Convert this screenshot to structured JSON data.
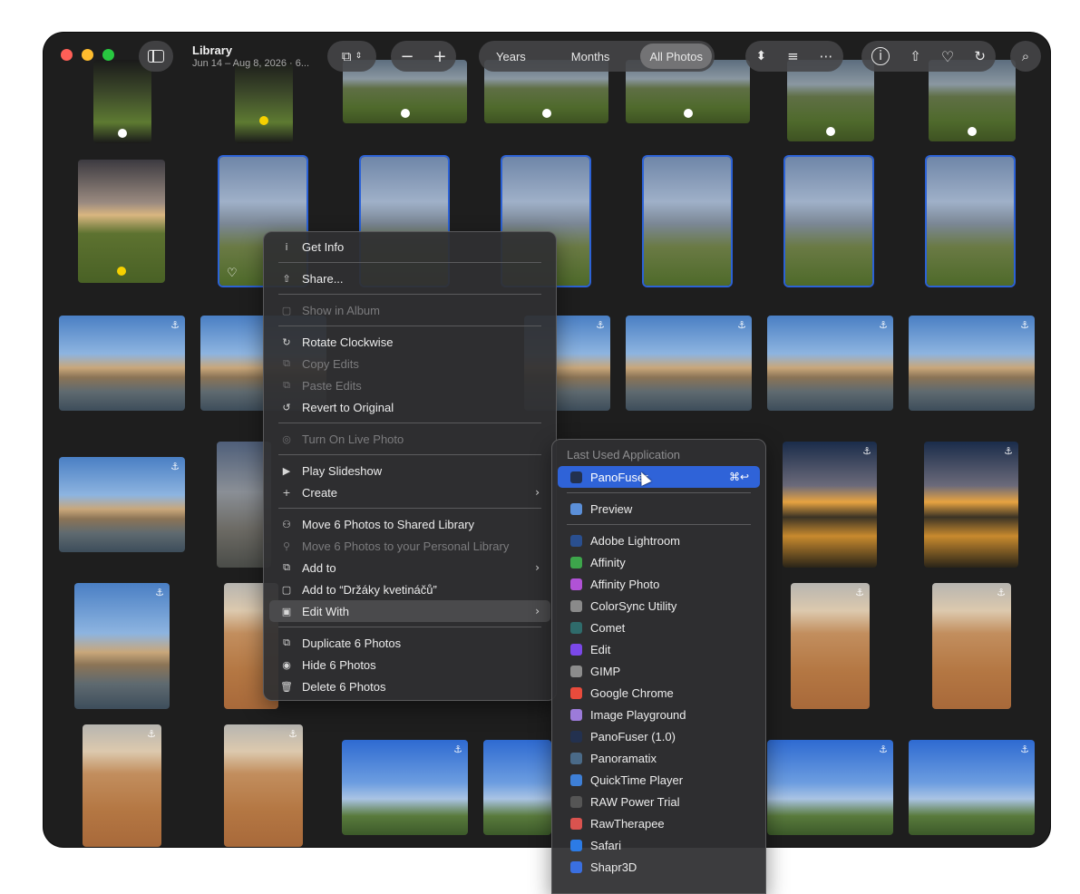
{
  "toolbar": {
    "title": "Library",
    "subtitle": "Jun 14 – Aug 8, 2026 · 6...",
    "view_tabs": [
      "Years",
      "Months",
      "All Photos"
    ],
    "active_tab": "All Photos"
  },
  "context_menu": {
    "get_info": "Get Info",
    "share": "Share...",
    "show_in_album": "Show in Album",
    "rotate": "Rotate Clockwise",
    "copy_edits": "Copy Edits",
    "paste_edits": "Paste Edits",
    "revert": "Revert to Original",
    "live_photo": "Turn On Live Photo",
    "slideshow": "Play Slideshow",
    "create": "Create",
    "move_shared": "Move 6 Photos to Shared Library",
    "move_personal": "Move 6 Photos to your Personal Library",
    "add_to": "Add to",
    "add_to_album": "Add to “Držáky kvetináčů”",
    "edit_with": "Edit With",
    "duplicate": "Duplicate 6 Photos",
    "hide": "Hide 6 Photos",
    "delete": "Delete 6 Photos"
  },
  "submenu": {
    "header": "Last Used Application",
    "last_used": "PanoFuser",
    "shortcut": "⌘↩",
    "preview": "Preview",
    "apps": [
      "Adobe Lightroom",
      "Affinity",
      "Affinity Photo",
      "ColorSync Utility",
      "Comet",
      "Edit",
      "GIMP",
      "Google Chrome",
      "Image Playground",
      "PanoFuser (1.0)",
      "Panoramatix",
      "QuickTime Player",
      "RAW Power Trial",
      "RawTherapee",
      "Safari",
      "Shapr3D"
    ]
  },
  "colors": {
    "accent": "#2f63d8",
    "selection": "#2c62d6",
    "close": "#ff5f57",
    "minimize": "#febc2e",
    "zoom": "#28c840"
  }
}
